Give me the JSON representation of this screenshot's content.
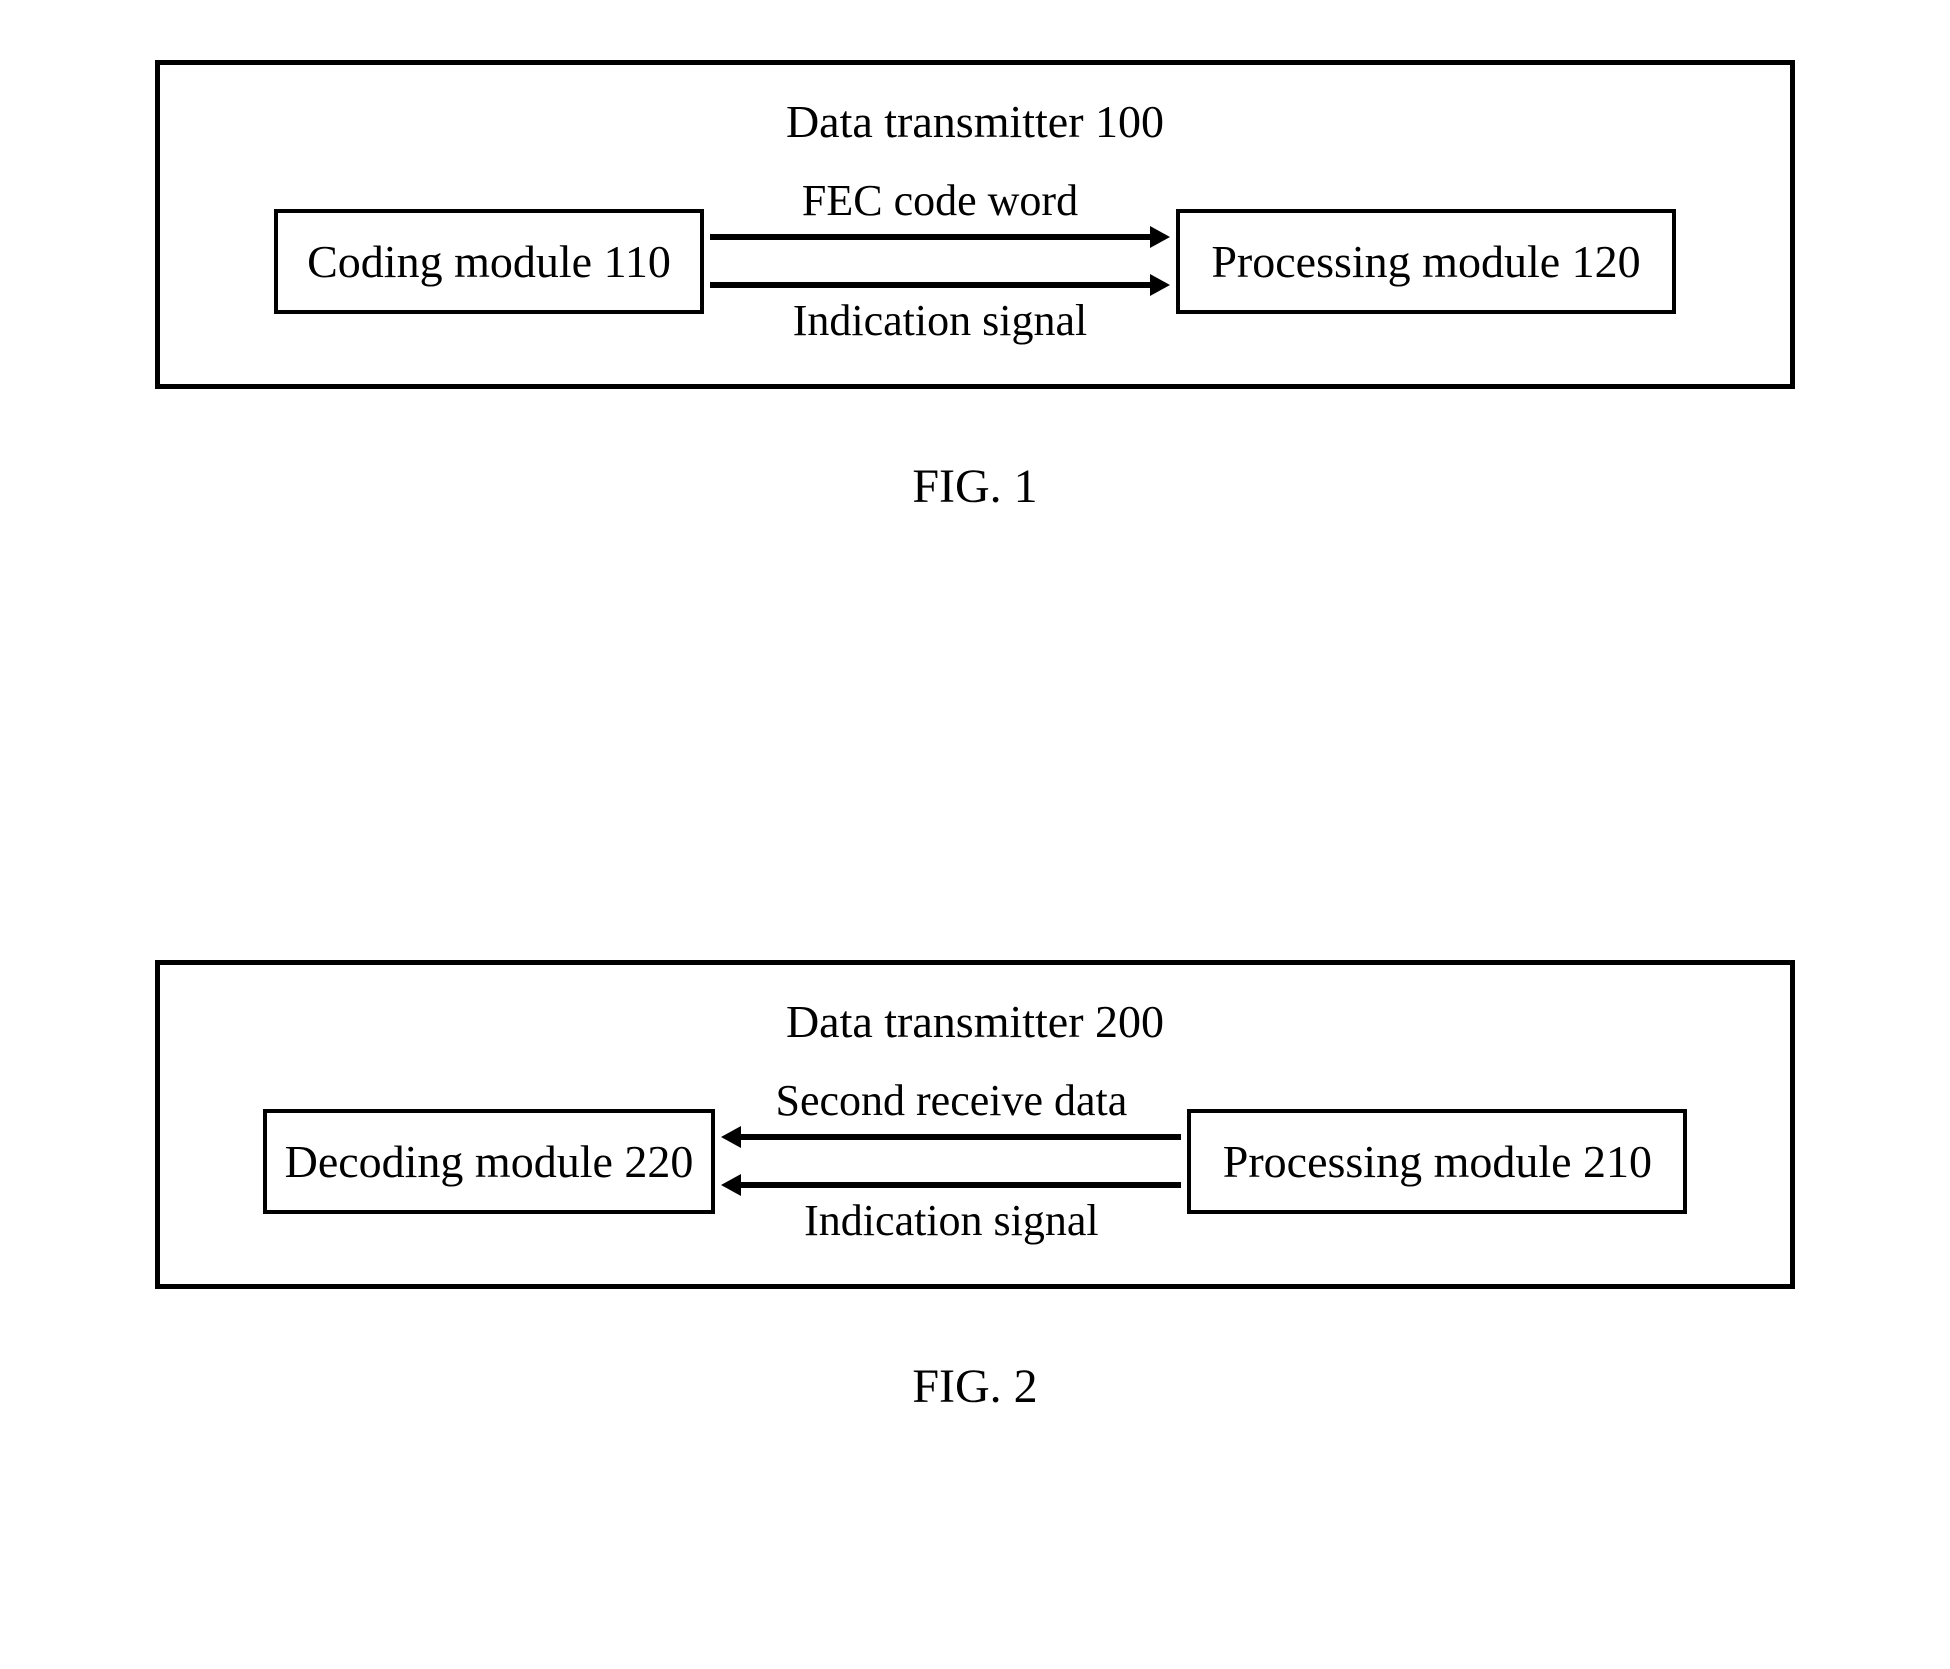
{
  "figures": [
    {
      "id": "fig1",
      "outer_title": "Data transmitter 100",
      "left_module": "Coding module 110",
      "right_module": "Processing module 120",
      "arrow_top_label": "FEC code word",
      "arrow_bottom_label": "Indication signal",
      "arrow_direction": "right",
      "caption": "FIG. 1"
    },
    {
      "id": "fig2",
      "outer_title": "Data transmitter 200",
      "left_module": "Decoding module 220",
      "right_module": "Processing module 210",
      "arrow_top_label": "Second receive data",
      "arrow_bottom_label": "Indication signal",
      "arrow_direction": "left",
      "caption": "FIG. 2"
    }
  ]
}
